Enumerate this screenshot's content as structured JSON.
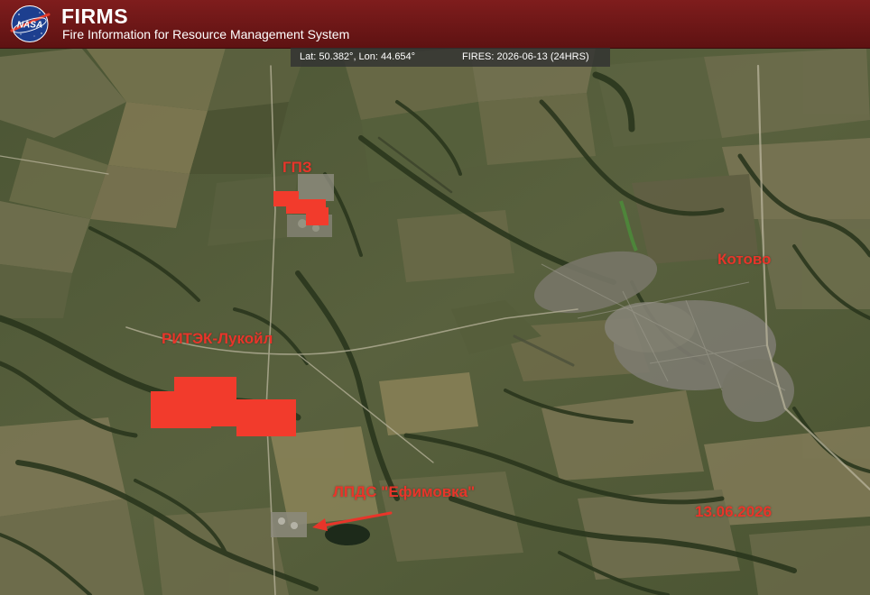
{
  "header": {
    "logo_text": "NASA",
    "title": "FIRMS",
    "subtitle": "Fire Information for Resource Management System"
  },
  "status": {
    "coordinates": "Lat: 50.382°, Lon: 44.654°",
    "fires": "FIRES: 2026-06-13 (24HRS)"
  },
  "map": {
    "labels": {
      "gpz": "ГПЗ",
      "ritek": "РИТЭК-Лукойл",
      "kotovo": "Котово",
      "lpds": "ЛПДС \"Ефимовка\"",
      "date": "13.06.2026"
    },
    "fire_detections": 6
  },
  "colors": {
    "header_bg": "#7f1d1d",
    "fire_marker": "#f23b2c",
    "label_text": "#e8352a",
    "status_bar_bg": "#323232"
  }
}
